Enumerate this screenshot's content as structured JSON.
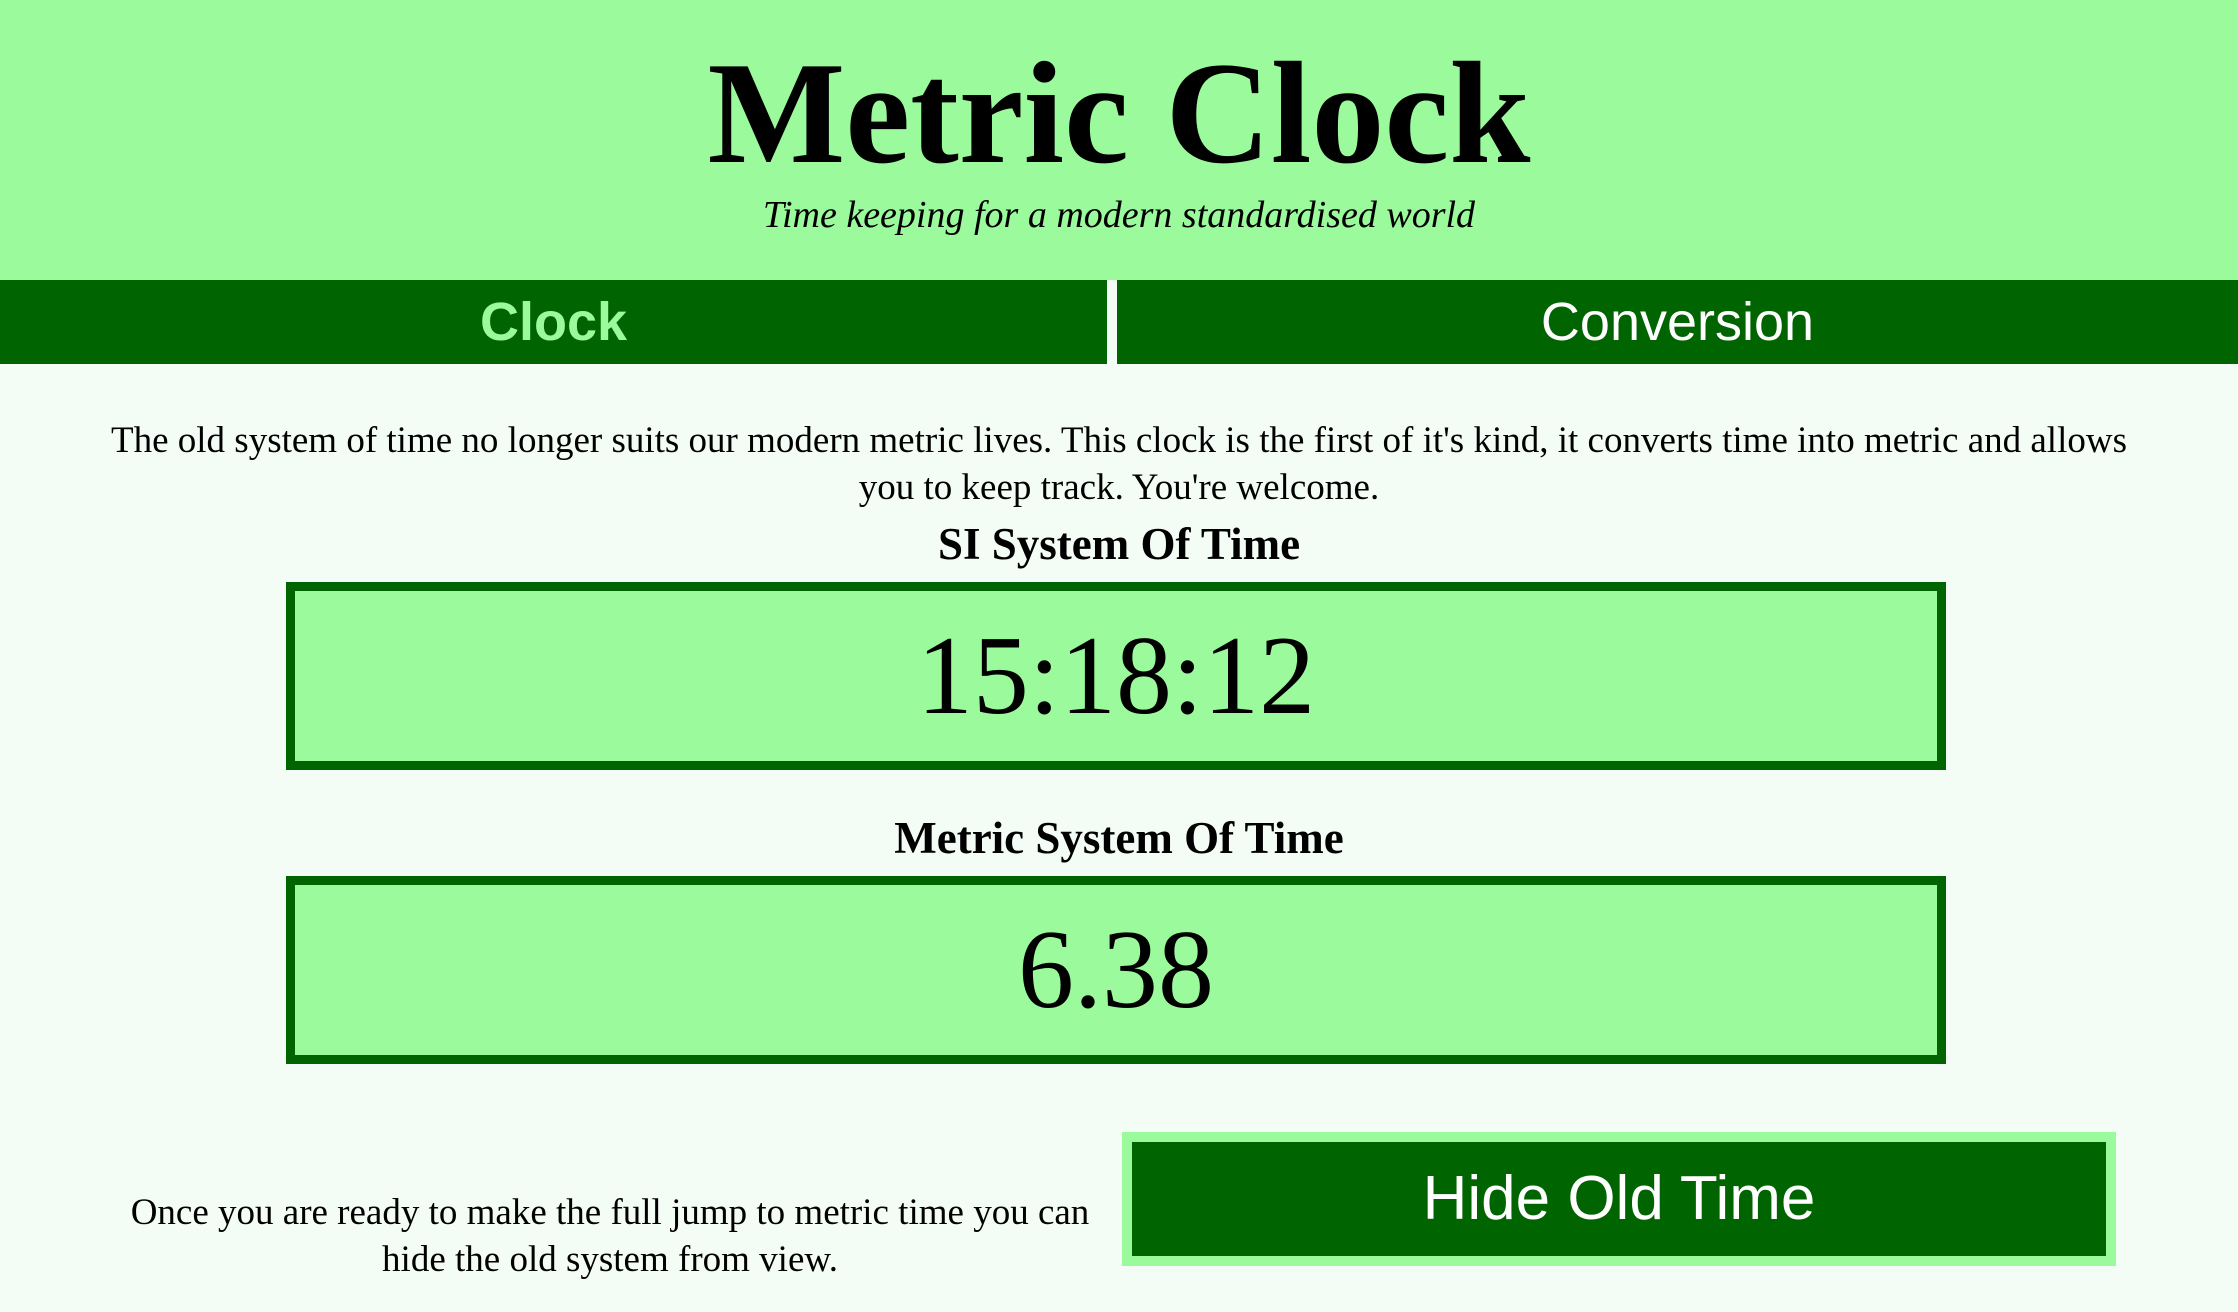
{
  "header": {
    "title": "Metric Clock",
    "subtitle": "Time keeping for a modern standardised world"
  },
  "nav": {
    "tabs": [
      {
        "label": "Clock",
        "active": true
      },
      {
        "label": "Conversion",
        "active": false
      }
    ]
  },
  "intro": {
    "text": "The old system of time no longer suits our modern metric lives. This clock is the first of it's kind, it converts time into metric and allows you to keep track. You're welcome."
  },
  "si_clock": {
    "label": "SI System Of Time",
    "value": "15:18:12"
  },
  "metric_clock": {
    "label": "Metric System Of Time",
    "value": "6.38"
  },
  "footer": {
    "text": "Once you are ready to make the full jump to metric time you can hide the old system from view.",
    "button_label": "Hide Old Time"
  },
  "colors": {
    "light_green": "#9bfa9c",
    "dark_green": "#006400",
    "page_background": "#f4fcf6"
  }
}
